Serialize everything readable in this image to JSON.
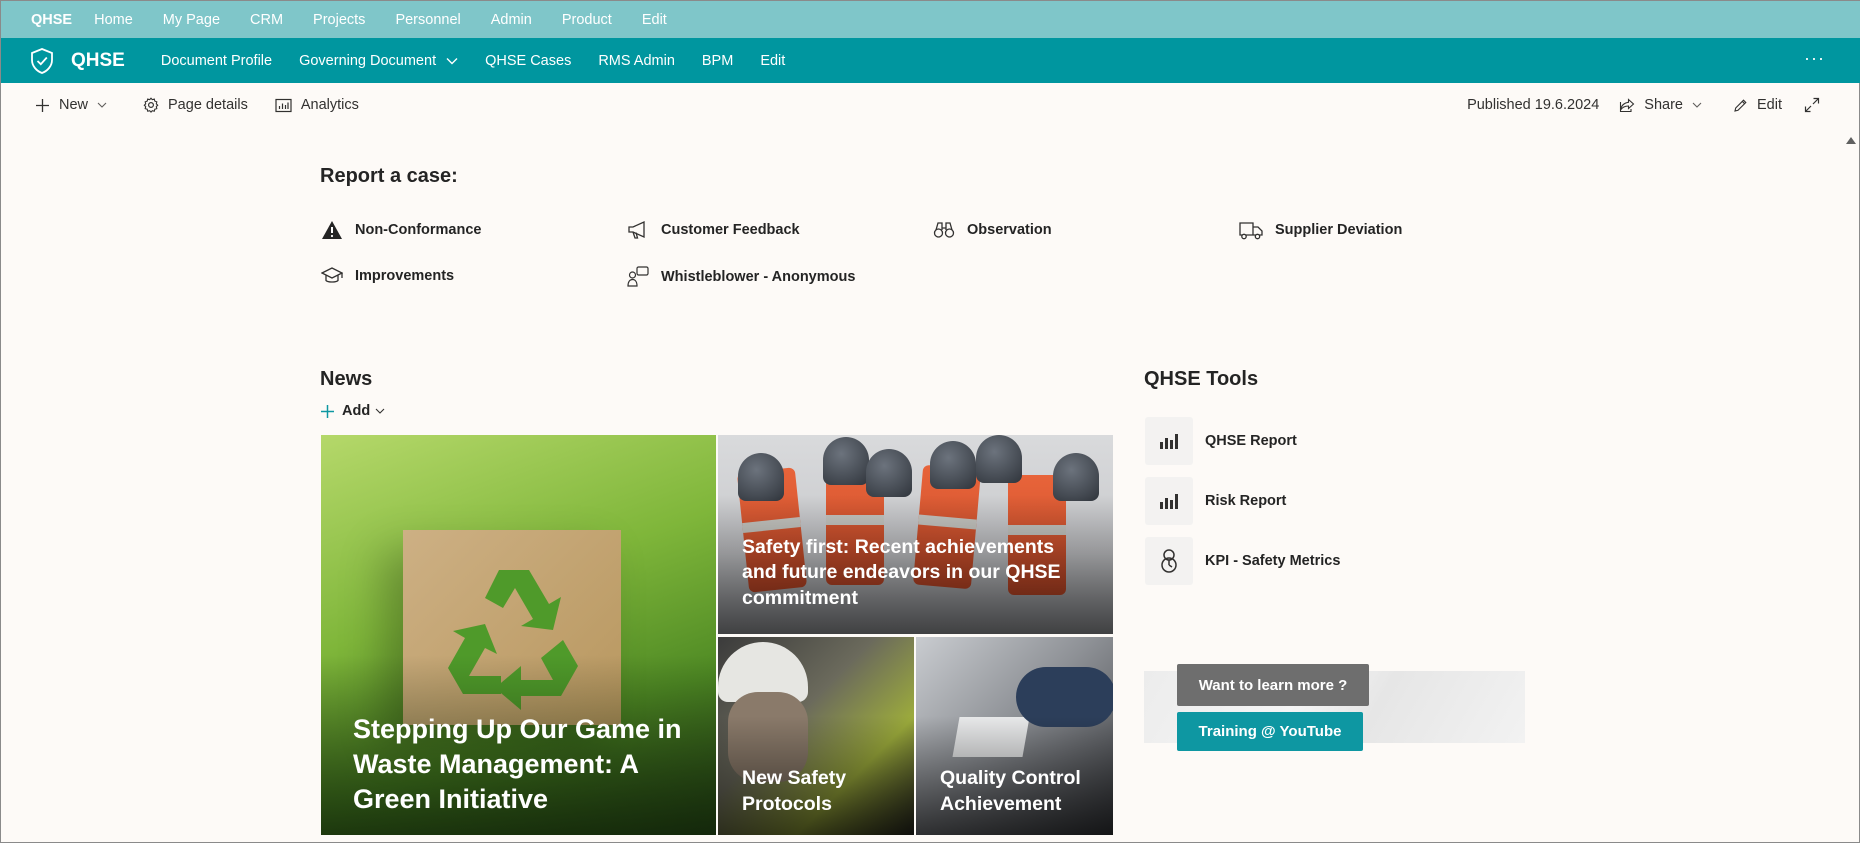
{
  "hub": {
    "items": [
      "QHSE",
      "Home",
      "My Page",
      "CRM",
      "Projects",
      "Personnel",
      "Admin",
      "Product",
      "Edit"
    ]
  },
  "site": {
    "title": "QHSE",
    "nav": [
      "Document Profile",
      "Governing Document",
      "QHSE Cases",
      "RMS Admin",
      "BPM",
      "Edit"
    ],
    "more": "···"
  },
  "command_bar": {
    "new_label": "New",
    "page_details_label": "Page details",
    "analytics_label": "Analytics",
    "published": "Published 19.6.2024",
    "share_label": "Share",
    "edit_label": "Edit"
  },
  "report": {
    "title": "Report a case:",
    "items": [
      {
        "label": "Non-Conformance",
        "icon": "warning-icon"
      },
      {
        "label": "Customer Feedback",
        "icon": "megaphone-icon"
      },
      {
        "label": "Observation",
        "icon": "binoculars-icon"
      },
      {
        "label": "Supplier Deviation",
        "icon": "truck-icon"
      },
      {
        "label": "Improvements",
        "icon": "graduation-cap-icon"
      },
      {
        "label": "Whistleblower - Anonymous",
        "icon": "people-chat-icon"
      }
    ]
  },
  "news": {
    "title": "News",
    "add_label": "Add",
    "articles": [
      {
        "title": "Stepping Up Our Game in Waste Management: A Green Initiative"
      },
      {
        "title": "Safety first: Recent achievements and future endeavors in our QHSE commitment"
      },
      {
        "title": "New Safety Protocols"
      },
      {
        "title": "Quality Control Achievement"
      }
    ]
  },
  "tools": {
    "title": "QHSE Tools",
    "items": [
      {
        "label": "QHSE Report",
        "icon": "bar-chart-icon"
      },
      {
        "label": "Risk Report",
        "icon": "bar-chart-icon"
      },
      {
        "label": "KPI - Safety Metrics",
        "icon": "gauge-icon"
      }
    ]
  },
  "learn": {
    "label": "Want to learn more ?",
    "button": "Training @ YouTube"
  },
  "colors": {
    "hub_bar": "#7fc6c9",
    "site_header": "#00969f",
    "accent": "#0e97a2",
    "background": "#fdfaf7"
  }
}
